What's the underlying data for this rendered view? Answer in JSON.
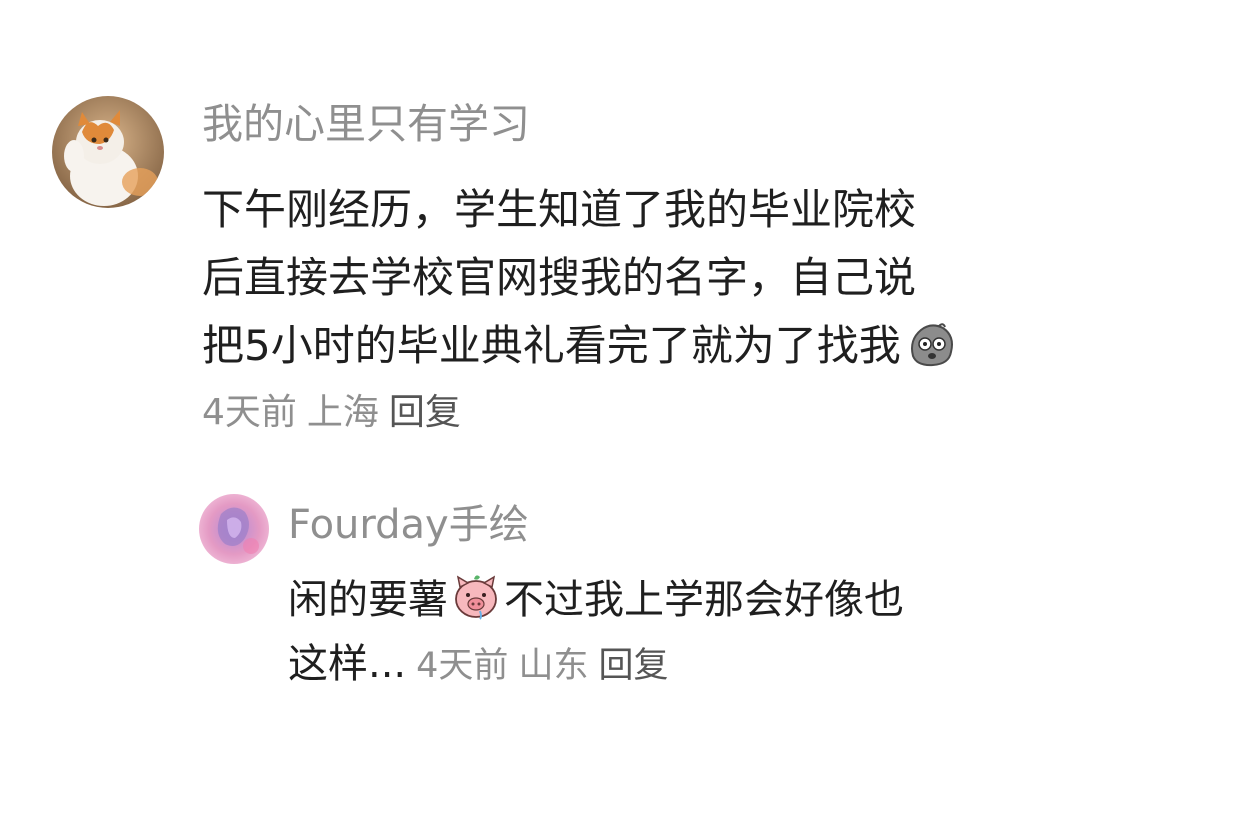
{
  "comment": {
    "username": "我的心里只有学习",
    "avatar_icon": "cat-avatar",
    "text_lines": [
      "下午刚经历，学生知道了我的毕业院校",
      "后直接去学校官网搜我的名字，自己说",
      "把5小时的毕业典礼看完了就为了找我"
    ],
    "emoji": "shocked-stone-emoji",
    "time": "4天前",
    "location": "上海",
    "reply_label": "回复"
  },
  "reply": {
    "username": "Fourday手绘",
    "avatar_icon": "pink-art-avatar",
    "text_part1": "闲的要薯",
    "emoji": "pig-emoji",
    "text_part2": "不过我上学那会好像也",
    "text_line2": "这样...",
    "time": "4天前",
    "location": "山东",
    "reply_label": "回复"
  },
  "colors": {
    "text": "#1f1f1f",
    "meta": "#8f8f8f",
    "reply_button": "#555555",
    "background": "#ffffff"
  }
}
